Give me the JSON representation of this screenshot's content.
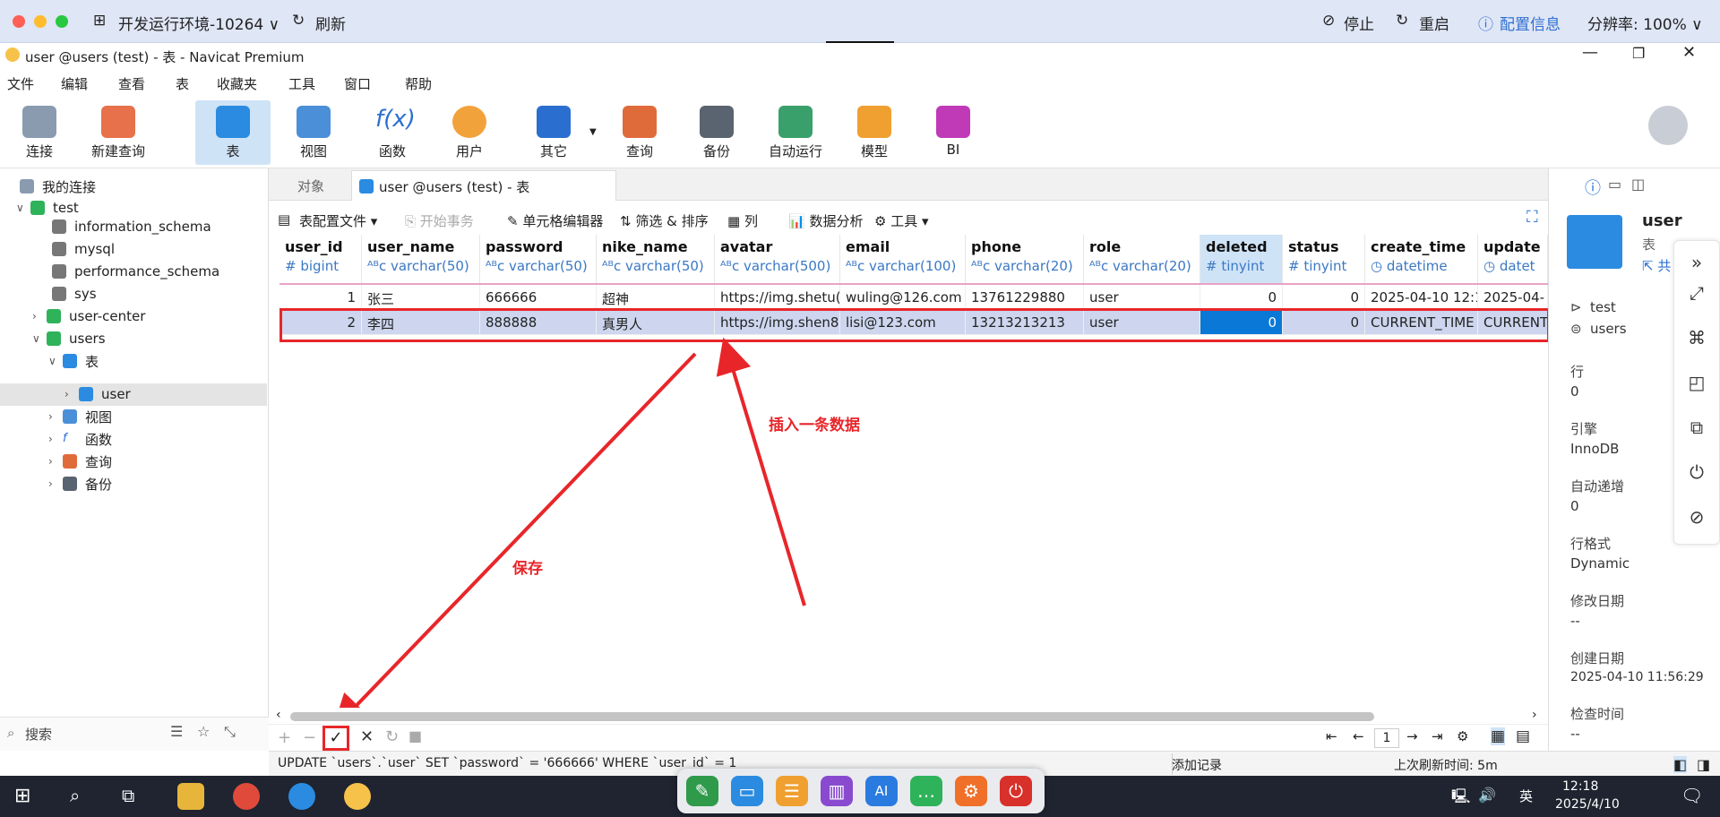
{
  "remote": {
    "env_label": "开发运行环境-10264",
    "refresh": "刷新",
    "stop": "停止",
    "restart": "重启",
    "config": "配置信息",
    "resolution": "分辨率: 100%"
  },
  "window": {
    "title": "user @users (test) - 表 - Navicat Premium"
  },
  "menu": [
    "文件",
    "编辑",
    "查看",
    "表",
    "收藏夹",
    "工具",
    "窗口",
    "帮助"
  ],
  "toolbar": [
    "连接",
    "新建查询",
    "表",
    "视图",
    "函数",
    "用户",
    "其它",
    "查询",
    "备份",
    "自动运行",
    "模型",
    "BI"
  ],
  "tree": {
    "root": "我的连接",
    "conn": "test",
    "dbs": [
      "information_schema",
      "mysql",
      "performance_schema",
      "sys",
      "user-center",
      "users"
    ],
    "tables_group": "表",
    "table": "user",
    "others": [
      "视图",
      "函数",
      "查询",
      "备份"
    ]
  },
  "search_placeholder": "搜索",
  "tabs": {
    "objects": "对象",
    "active": "user @users (test) - 表"
  },
  "gridbar": {
    "profile": "表配置文件",
    "begin_tx": "开始事务",
    "cell_editor": "单元格编辑器",
    "filter_sort": "筛选 & 排序",
    "columns": "列",
    "analysis": "数据分析",
    "tools": "工具"
  },
  "columns": [
    {
      "name": "user_id",
      "type": "bigint",
      "icon": "#"
    },
    {
      "name": "user_name",
      "type": "varchar(50)",
      "icon": "ABC"
    },
    {
      "name": "password",
      "type": "varchar(50)",
      "icon": "ABC"
    },
    {
      "name": "nike_name",
      "type": "varchar(50)",
      "icon": "ABC"
    },
    {
      "name": "avatar",
      "type": "varchar(500)",
      "icon": "ABC"
    },
    {
      "name": "email",
      "type": "varchar(100)",
      "icon": "ABC"
    },
    {
      "name": "phone",
      "type": "varchar(20)",
      "icon": "ABC"
    },
    {
      "name": "role",
      "type": "varchar(20)",
      "icon": "ABC"
    },
    {
      "name": "deleted",
      "type": "tinyint",
      "icon": "#"
    },
    {
      "name": "status",
      "type": "tinyint",
      "icon": "#"
    },
    {
      "name": "create_time",
      "type": "datetime",
      "icon": "clock"
    },
    {
      "name": "update",
      "type": "datet",
      "icon": "clock"
    }
  ],
  "rows": [
    [
      "1",
      "张三",
      "666666",
      "超神",
      "https://img.shetu(",
      "wuling@126.com",
      "13761229880",
      "user",
      "0",
      "0",
      "2025-04-10 12:1",
      "2025-04-"
    ],
    [
      "2",
      "李四",
      "888888",
      "真男人",
      "https://img.shen8",
      "lisi@123.com",
      "13213213213",
      "user",
      "0",
      "0",
      "CURRENT_TIME",
      "CURRENT"
    ]
  ],
  "page_number": "1",
  "status": {
    "sql": "UPDATE `users`.`user` SET `password` = '666666' WHERE `user_id` = 1",
    "mode": "添加记录",
    "refresh": "上次刷新时间: 5m"
  },
  "info": {
    "name": "user",
    "kind": "表",
    "share": "共",
    "conn": "test",
    "db": "users",
    "rows_label": "行",
    "rows": "0",
    "engine_label": "引擎",
    "engine": "InnoDB",
    "auto_inc_label": "自动递增",
    "auto_inc": "0",
    "row_format_label": "行格式",
    "row_format": "Dynamic",
    "modified_label": "修改日期",
    "modified": "--",
    "created_label": "创建日期",
    "created": "2025-04-10 11:56:29",
    "checked_label": "检查时间",
    "checked": "--"
  },
  "annotations": {
    "insert": "插入一条数据",
    "save": "保存"
  },
  "clock": {
    "time": "12:18",
    "date": "2025/4/10",
    "ime": "英"
  },
  "colors": {
    "accent": "#0a78d7",
    "highlight": "#e8262a",
    "selected_row": "#cdd6ee"
  }
}
